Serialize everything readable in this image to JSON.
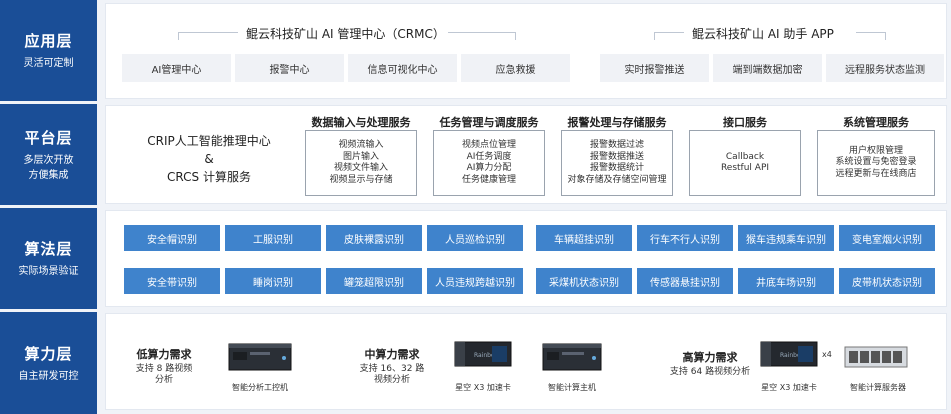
{
  "layers": [
    {
      "title": "应用层",
      "subtitle": [
        "灵活可定制"
      ]
    },
    {
      "title": "平台层",
      "subtitle": [
        "多层次开放",
        "方便集成"
      ]
    },
    {
      "title": "算法层",
      "subtitle": [
        "实际场景验证"
      ]
    },
    {
      "title": "算力层",
      "subtitle": [
        "自主研发可控"
      ]
    }
  ],
  "app": {
    "crmc_title": "鲲云科技矿山 AI 管理中心（CRMC）",
    "crmc_items": [
      "AI管理中心",
      "报警中心",
      "信息可视化中心",
      "应急救援"
    ],
    "app_title": "鲲云科技矿山 AI 助手 APP",
    "app_items": [
      "实时报警推送",
      "端到端数据加密",
      "远程服务状态监测"
    ]
  },
  "platform": {
    "crip": [
      "CRIP人工智能推理中心",
      "&",
      "CRCS 计算服务"
    ],
    "services": [
      {
        "title": "数据输入与处理服务",
        "items": [
          "视频流输入",
          "图片输入",
          "视频文件输入",
          "视频显示与存储"
        ]
      },
      {
        "title": "任务管理与调度服务",
        "items": [
          "视频点位管理",
          "AI任务调度",
          "AI算力分配",
          "任务健康管理"
        ]
      },
      {
        "title": "报警处理与存储服务",
        "items": [
          "报警数据过滤",
          "报警数据推送",
          "报警数据统计",
          "对象存储及存储空间管理"
        ]
      },
      {
        "title": "接口服务",
        "items": [
          "Callback",
          "Restful API"
        ]
      },
      {
        "title": "系统管理服务",
        "items": [
          "用户权限管理",
          "系统设置与免密登录",
          "远程更新与在线商店"
        ]
      }
    ]
  },
  "algorithms": {
    "row1": [
      "安全帽识别",
      "工服识别",
      "皮肤裸露识别",
      "人员巡检识别",
      "车辆超挂识别",
      "行车不行人识别",
      "猴车违规乘车识别",
      "变电室烟火识别"
    ],
    "row2": [
      "安全带识别",
      "睡岗识别",
      "罐笼超限识别",
      "人员违规跨越识别",
      "采煤机状态识别",
      "传感器悬挂识别",
      "井底车场识别",
      "皮带机状态识别"
    ]
  },
  "compute": {
    "low": {
      "title": "低算力需求",
      "desc": [
        "支持 8 路视频",
        "分析"
      ],
      "devices": [
        "智能分析工控机"
      ]
    },
    "mid": {
      "title": "中算力需求",
      "desc": [
        "支持 16、32 路",
        "视频分析"
      ],
      "devices": [
        "星空 X3 加速卡",
        "智能计算主机"
      ]
    },
    "high": {
      "title": "高算力需求",
      "desc": [
        "支持 64 路视频分析"
      ],
      "devices": [
        "星空 X3 加速卡",
        "智能计算服务器"
      ],
      "multiplier": "x4"
    },
    "card_brand": "Rainbow"
  },
  "colors": {
    "sidebar": "#1a4e97",
    "algo": "#3f83cc",
    "gray_box": "#f0f2f6"
  }
}
